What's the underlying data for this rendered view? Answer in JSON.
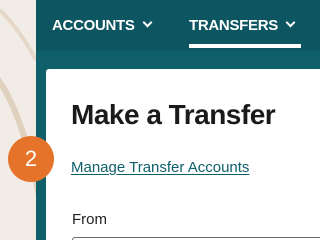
{
  "nav": {
    "accounts_label": "ACCOUNTS",
    "transfers_label": "TRANSFERS"
  },
  "main": {
    "title": "Make a Transfer",
    "manage_link": "Manage Transfer Accounts",
    "from_label": "From"
  },
  "annotation": {
    "step_number": "2"
  },
  "colors": {
    "nav_background": "#0d5560",
    "panel_rail": "#0e5f69",
    "link": "#0d5f6a",
    "badge": "#e5742a",
    "page_background": "#f1ece6"
  }
}
